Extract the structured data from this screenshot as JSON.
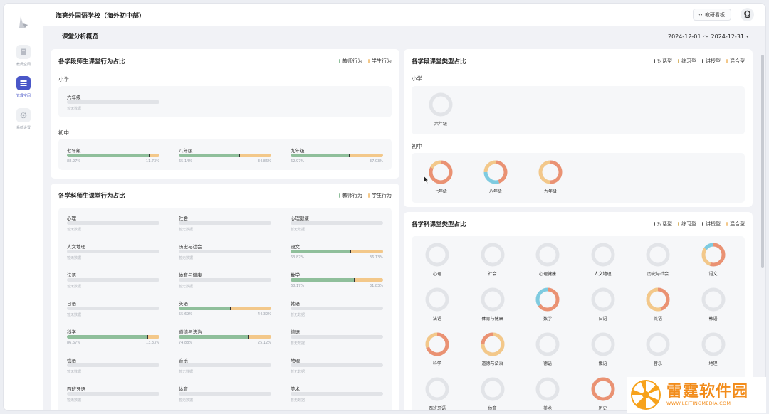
{
  "header": {
    "school_name": "海亮外国语学校（海外初中部）",
    "board_button": "教研看板",
    "board_icon": "dots-icon",
    "avatar_icon": "user-avatar-icon"
  },
  "sidebar": {
    "items": [
      {
        "label": "教师空间",
        "icon": "book-icon",
        "active": false
      },
      {
        "label": "管理空间",
        "icon": "dashboard-icon",
        "active": true
      },
      {
        "label": "系统设置",
        "icon": "gear-icon",
        "active": false
      }
    ]
  },
  "page": {
    "title": "课堂分析概览",
    "date_start": "2024-12-01",
    "date_sep": "～",
    "date_end": "2024-12-31"
  },
  "colors": {
    "teacher": "#8fbf9b",
    "student": "#f3c88a",
    "dialogue": "#7ecbe0",
    "practice": "#f3c88a",
    "lecture": "#ea9273",
    "mixed": "#f3c88a",
    "empty": "#e2e4e8",
    "accent": "#4a57c8"
  },
  "stage_behavior": {
    "title": "各学段师生课堂行为占比",
    "legend": [
      "教师行为",
      "学生行为"
    ],
    "groups": [
      {
        "label": "小学",
        "items": [
          {
            "name": "六年级",
            "empty": true,
            "note": "暂无数据"
          }
        ]
      },
      {
        "label": "初中",
        "items": [
          {
            "name": "七年级",
            "teacher": "88.27%",
            "student": "11.73%",
            "teacher_frac": 0.8827
          },
          {
            "name": "八年级",
            "teacher": "65.14%",
            "student": "34.86%",
            "teacher_frac": 0.6514
          },
          {
            "name": "九年级",
            "teacher": "62.97%",
            "student": "37.03%",
            "teacher_frac": 0.6297
          }
        ]
      }
    ]
  },
  "subject_behavior": {
    "title": "各学科师生课堂行为占比",
    "legend": [
      "教师行为",
      "学生行为"
    ],
    "items": [
      {
        "name": "心理",
        "empty": true,
        "note": "暂无数据"
      },
      {
        "name": "社会",
        "empty": true,
        "note": "暂无数据"
      },
      {
        "name": "心理健康",
        "empty": true,
        "note": "暂无数据"
      },
      {
        "name": "人文地理",
        "empty": true,
        "note": "暂无数据"
      },
      {
        "name": "历史与社会",
        "empty": true,
        "note": "暂无数据"
      },
      {
        "name": "语文",
        "teacher": "63.87%",
        "student": "36.13%",
        "teacher_frac": 0.6387
      },
      {
        "name": "法语",
        "empty": true,
        "note": "暂无数据"
      },
      {
        "name": "体育与健康",
        "empty": true,
        "note": "暂无数据"
      },
      {
        "name": "数学",
        "teacher": "68.17%",
        "student": "31.83%",
        "teacher_frac": 0.6817
      },
      {
        "name": "日语",
        "empty": true,
        "note": "暂无数据"
      },
      {
        "name": "英语",
        "teacher": "55.69%",
        "student": "44.32%",
        "teacher_frac": 0.5569
      },
      {
        "name": "韩语",
        "empty": true,
        "note": "暂无数据"
      },
      {
        "name": "科学",
        "teacher": "86.67%",
        "student": "13.33%",
        "teacher_frac": 0.8667
      },
      {
        "name": "道德与法治",
        "teacher": "74.88%",
        "student": "25.12%",
        "teacher_frac": 0.7488
      },
      {
        "name": "德语",
        "empty": true,
        "note": "暂无数据"
      },
      {
        "name": "俄语",
        "empty": true,
        "note": "暂无数据"
      },
      {
        "name": "音乐",
        "empty": true,
        "note": "暂无数据"
      },
      {
        "name": "地理",
        "empty": true,
        "note": "暂无数据"
      },
      {
        "name": "西班牙语",
        "empty": true,
        "note": "暂无数据"
      },
      {
        "name": "体育",
        "empty": true,
        "note": "暂无数据"
      },
      {
        "name": "美术",
        "empty": true,
        "note": "暂无数据"
      }
    ]
  },
  "stage_type": {
    "title": "各学段课堂类型占比",
    "legend": [
      "对话型",
      "练习型",
      "讲授型",
      "混合型"
    ],
    "groups": [
      {
        "label": "小学",
        "items": [
          {
            "name": "六年级",
            "mix": []
          }
        ]
      },
      {
        "label": "初中",
        "items": [
          {
            "name": "七年级",
            "mix": [
              {
                "type": "lecture",
                "frac": 0.82
              },
              {
                "type": "mixed",
                "frac": 0.18
              }
            ]
          },
          {
            "name": "八年级",
            "mix": [
              {
                "type": "lecture",
                "frac": 0.45
              },
              {
                "type": "dialogue",
                "frac": 0.3
              },
              {
                "type": "mixed",
                "frac": 0.25
              }
            ]
          },
          {
            "name": "九年级",
            "mix": [
              {
                "type": "lecture",
                "frac": 0.5
              },
              {
                "type": "mixed",
                "frac": 0.5
              }
            ]
          }
        ]
      }
    ]
  },
  "subject_type": {
    "title": "各学科课堂类型占比",
    "legend": [
      "对话型",
      "练习型",
      "讲授型",
      "混合型"
    ],
    "items": [
      {
        "name": "心理",
        "mix": []
      },
      {
        "name": "社会",
        "mix": []
      },
      {
        "name": "心理健康",
        "mix": []
      },
      {
        "name": "人文地理",
        "mix": []
      },
      {
        "name": "历史与社会",
        "mix": []
      },
      {
        "name": "语文",
        "mix": [
          {
            "type": "lecture",
            "frac": 0.55
          },
          {
            "type": "mixed",
            "frac": 0.3
          },
          {
            "type": "dialogue",
            "frac": 0.15
          }
        ]
      },
      {
        "name": "法语",
        "mix": []
      },
      {
        "name": "体育与健康",
        "mix": []
      },
      {
        "name": "数学",
        "mix": [
          {
            "type": "lecture",
            "frac": 0.65
          },
          {
            "type": "dialogue",
            "frac": 0.35
          }
        ]
      },
      {
        "name": "日语",
        "mix": []
      },
      {
        "name": "英语",
        "mix": [
          {
            "type": "lecture",
            "frac": 0.45
          },
          {
            "type": "mixed",
            "frac": 0.55
          }
        ]
      },
      {
        "name": "韩语",
        "mix": []
      },
      {
        "name": "科学",
        "mix": [
          {
            "type": "lecture",
            "frac": 0.7
          },
          {
            "type": "mixed",
            "frac": 0.3
          }
        ]
      },
      {
        "name": "道德与法治",
        "mix": [
          {
            "type": "mixed",
            "frac": 0.75
          },
          {
            "type": "lecture",
            "frac": 0.25
          }
        ]
      },
      {
        "name": "德语",
        "mix": []
      },
      {
        "name": "俄语",
        "mix": []
      },
      {
        "name": "音乐",
        "mix": []
      },
      {
        "name": "地理",
        "mix": []
      },
      {
        "name": "西班牙语",
        "mix": []
      },
      {
        "name": "体育",
        "mix": []
      },
      {
        "name": "美术",
        "mix": []
      },
      {
        "name": "历史",
        "mix": [
          {
            "type": "lecture",
            "frac": 1.0
          }
        ]
      }
    ]
  },
  "watermark": {
    "text": "雷霆软件园",
    "url": "WWW.LEITINGMEDIA.COM"
  }
}
